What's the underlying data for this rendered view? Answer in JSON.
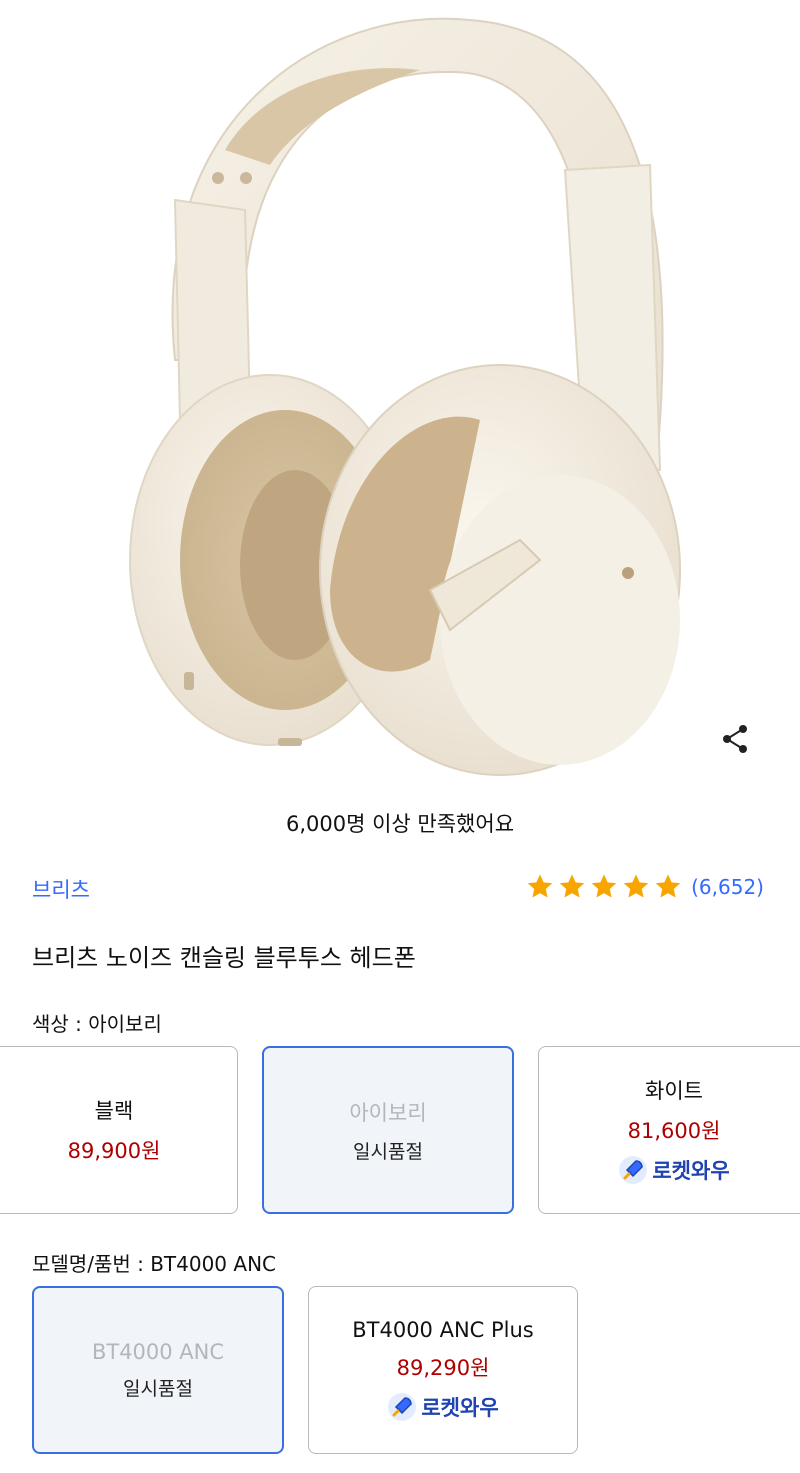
{
  "hero": {
    "share_icon": "share-icon"
  },
  "satisfaction_text": "6,000명 이상 만족했어요",
  "brand": "브리츠",
  "rating": {
    "stars": 5,
    "count": "(6,652)"
  },
  "product_title": "브리츠 노이즈 캔슬링 블루투스 헤드폰",
  "color_section": {
    "label": "색상 : 아이보리",
    "options": [
      {
        "name": "블랙",
        "price": "89,900원"
      },
      {
        "name": "아이보리",
        "status": "일시품절"
      },
      {
        "name": "화이트",
        "price": "81,600원",
        "badge": "로켓와우"
      }
    ]
  },
  "model_section": {
    "label": "모델명/품번 : BT4000 ANC",
    "options": [
      {
        "name": "BT4000 ANC",
        "status": "일시품절"
      },
      {
        "name": "BT4000 ANC Plus",
        "price": "89,290원",
        "badge": "로켓와우"
      }
    ]
  },
  "colors": {
    "accent": "#346aff",
    "price": "#ae0000",
    "star": "#f7a600",
    "selected_border": "#3a6fe2"
  }
}
